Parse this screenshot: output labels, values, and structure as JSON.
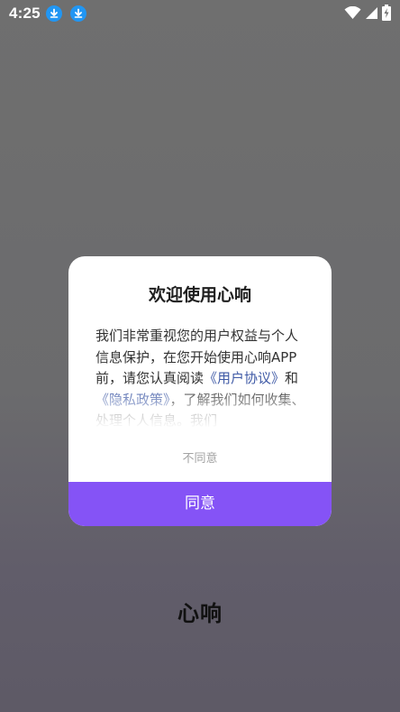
{
  "status_bar": {
    "time": "4:25",
    "notifications": [
      "download-icon",
      "download-icon"
    ],
    "indicators": [
      "wifi-icon",
      "cellular-signal-icon",
      "battery-charging-icon"
    ]
  },
  "dialog": {
    "title": "欢迎使用心响",
    "body_prefix": "我们非常重视您的用户权益与个人信息保护，在您开始使用心响APP前，请您认真阅读",
    "link_user_agreement": "《用户协议》",
    "conjunction": "和",
    "link_privacy_policy": "《隐私政策》",
    "body_suffix": "，了解我们如何收集、处理个人信息。我们",
    "disagree_label": "不同意",
    "agree_label": "同意"
  },
  "brand": {
    "name": "心响"
  },
  "colors": {
    "accent": "#8553f6",
    "link": "#3f5aa6",
    "notification_badge": "#2196f3"
  }
}
